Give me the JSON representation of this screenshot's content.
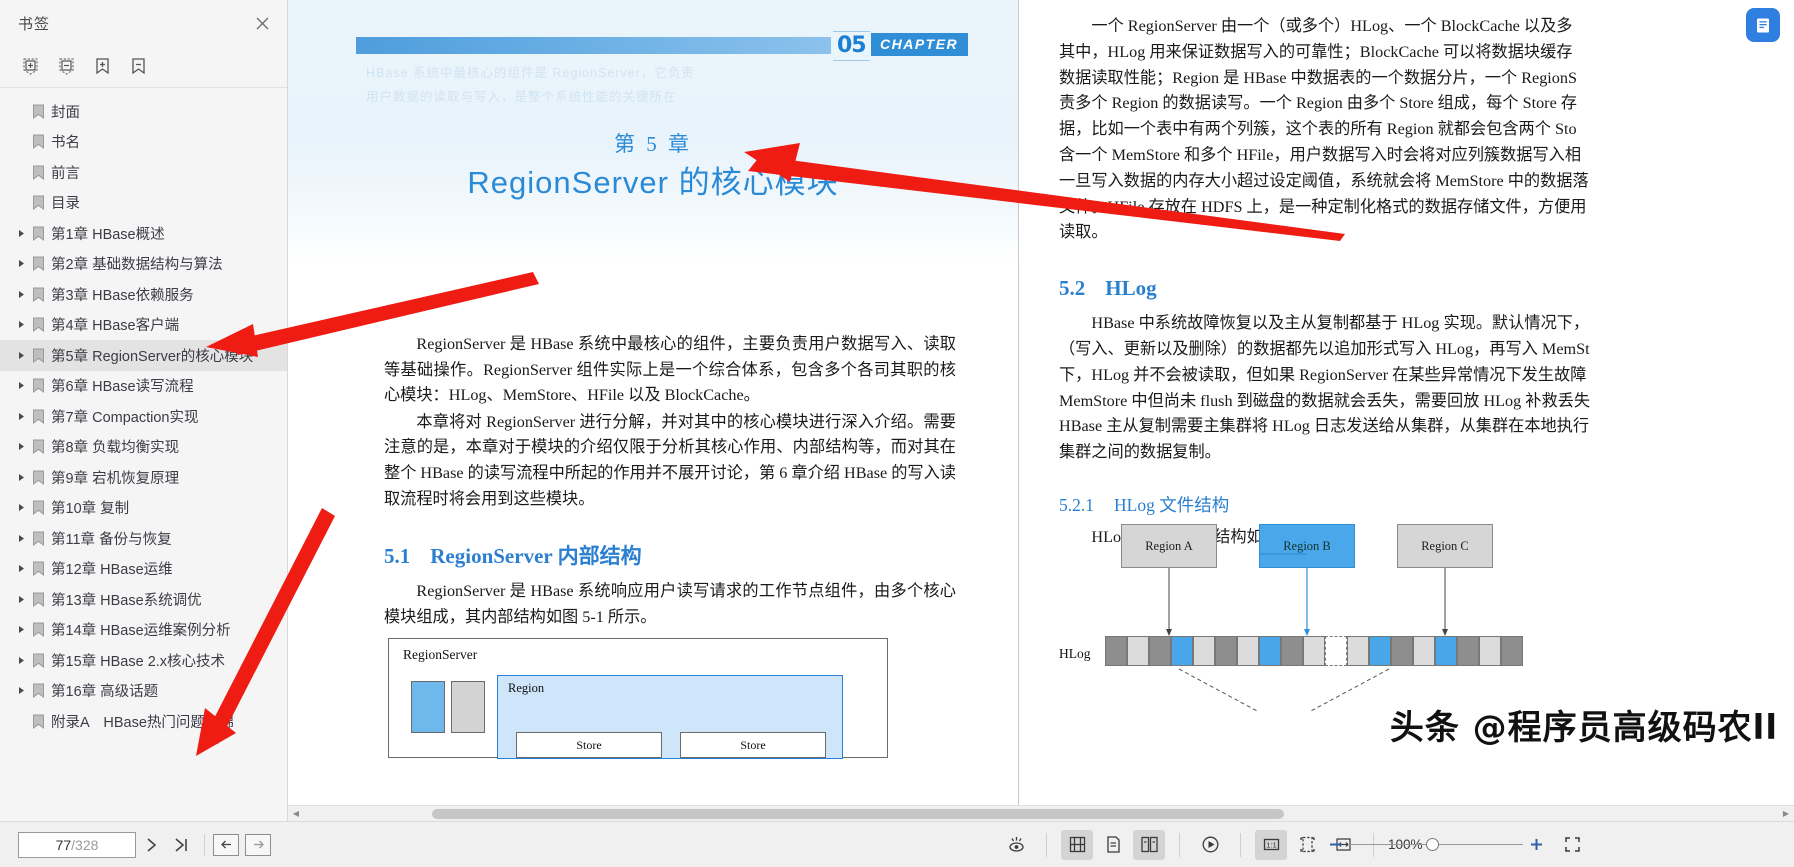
{
  "sidebar": {
    "title": "书签",
    "close_icon": "close-icon",
    "tools": [
      {
        "name": "expand-all-icon",
        "label": "展开全部"
      },
      {
        "name": "collapse-all-icon",
        "label": "收起全部"
      },
      {
        "name": "add-bookmark-icon",
        "label": "添加书签"
      },
      {
        "name": "remove-bookmark-icon",
        "label": "删除书签"
      }
    ],
    "items": [
      {
        "label": "封面",
        "expandable": false,
        "selected": false
      },
      {
        "label": "书名",
        "expandable": false,
        "selected": false
      },
      {
        "label": "前言",
        "expandable": false,
        "selected": false
      },
      {
        "label": "目录",
        "expandable": false,
        "selected": false
      },
      {
        "label": "第1章 HBase概述",
        "expandable": true,
        "selected": false
      },
      {
        "label": "第2章 基础数据结构与算法",
        "expandable": true,
        "selected": false
      },
      {
        "label": "第3章 HBase依赖服务",
        "expandable": true,
        "selected": false
      },
      {
        "label": "第4章 HBase客户端",
        "expandable": true,
        "selected": false
      },
      {
        "label": "第5章 RegionServer的核心模块",
        "expandable": true,
        "selected": true
      },
      {
        "label": "第6章 HBase读写流程",
        "expandable": true,
        "selected": false
      },
      {
        "label": "第7章 Compaction实现",
        "expandable": true,
        "selected": false
      },
      {
        "label": "第8章 负载均衡实现",
        "expandable": true,
        "selected": false
      },
      {
        "label": "第9章 宕机恢复原理",
        "expandable": true,
        "selected": false
      },
      {
        "label": "第10章 复制",
        "expandable": true,
        "selected": false
      },
      {
        "label": "第11章 备份与恢复",
        "expandable": true,
        "selected": false
      },
      {
        "label": "第12章 HBase运维",
        "expandable": true,
        "selected": false
      },
      {
        "label": "第13章 HBase系统调优",
        "expandable": true,
        "selected": false
      },
      {
        "label": "第14章 HBase运维案例分析",
        "expandable": true,
        "selected": false
      },
      {
        "label": "第15章 HBase 2.x核心技术",
        "expandable": true,
        "selected": false
      },
      {
        "label": "第16章 高级话题",
        "expandable": true,
        "selected": false
      },
      {
        "label": "附录A　HBase热门问题集锦",
        "expandable": false,
        "selected": false
      }
    ]
  },
  "left_page": {
    "chapter_number_badge": "05",
    "chapter_word_badge": "CHAPTER",
    "chapter_label": "第 5 章",
    "chapter_title": "RegionServer 的核心模块",
    "ghost_lines": [
      "HBase 系统中最核心的组件是 RegionServer，它负责",
      "用户数据的读取与写入，是整个系统性能的关键所在"
    ],
    "paragraphs": [
      "RegionServer 是 HBase 系统中最核心的组件，主要负责用户数据写入、读取等基础操作。RegionServer 组件实际上是一个综合体系，包含多个各司其职的核心模块：HLog、MemStore、HFile 以及 BlockCache。",
      "本章将对 RegionServer 进行分解，并对其中的核心模块进行深入介绍。需要注意的是，本章对于模块的介绍仅限于分析其核心作用、内部结构等，而对其在整个 HBase 的读写流程中所起的作用并不展开讨论，第 6 章介绍 HBase 的写入读取流程时将会用到这些模块。"
    ],
    "section": {
      "num": "5.1",
      "title": "RegionServer 内部结构"
    },
    "section_paragraph": "RegionServer 是 HBase 系统响应用户读写请求的工作节点组件，由多个核心模块组成，其内部结构如图 5-1 所示。",
    "figure": {
      "outer_label": "RegionServer",
      "region_label": "Region",
      "store_labels": [
        "Store",
        "Store"
      ]
    }
  },
  "right_page": {
    "paragraph_lines": [
      "一个 RegionServer 由一个（或多个）HLog、一个 BlockCache 以及多",
      "其中，HLog 用来保证数据写入的可靠性；BlockCache 可以将数据块缓存",
      "数据读取性能；Region 是 HBase 中数据表的一个数据分片，一个 RegionS",
      "责多个 Region 的数据读写。一个 Region 由多个 Store 组成，每个 Store 存",
      "据，比如一个表中有两个列簇，这个表的所有 Region 就都会包含两个 Sto",
      "含一个 MemStore 和多个 HFile，用户数据写入时会将对应列簇数据写入相",
      "一旦写入数据的内存大小超过设定阈值，系统就会将 MemStore 中的数据落",
      "文件。HFile 存放在 HDFS 上，是一种定制化格式的数据存储文件，方便用",
      "读取。"
    ],
    "section": {
      "num": "5.2",
      "title": "HLog"
    },
    "section_lines": [
      "HBase 中系统故障恢复以及主从复制都基于 HLog 实现。默认情况下，",
      "（写入、更新以及删除）的数据都先以追加形式写入 HLog，再写入 MemSt",
      "下，HLog 并不会被读取，但如果 RegionServer 在某些异常情况下发生故障",
      "MemStore 中但尚未 flush 到磁盘的数据就会丢失，需要回放 HLog 补救丢失",
      "HBase 主从复制需要主集群将 HLog 日志发送给从集群，从集群在本地执行",
      "集群之间的数据复制。"
    ],
    "subsection": {
      "num": "5.2.1",
      "title": "HLog 文件结构"
    },
    "subsection_paragraph": "HLog 文件的基本结构如图 5-2 所示。",
    "diagram": {
      "regions": [
        "Region A",
        "Region B",
        "Region C"
      ],
      "hlog_label": "HLog"
    }
  },
  "watermark": "头条 @程序员高级码农ll",
  "float_button": {
    "icon": "document-badge-icon"
  },
  "bottombar": {
    "current_page": "77",
    "total_pages": "/328",
    "next_page_icon": "chevron-right-icon",
    "last_page_icon": "last-page-icon",
    "back_icon": "arrow-left-icon",
    "forward_icon": "arrow-right-icon",
    "tools": [
      {
        "name": "read-aloud-icon",
        "active": false
      },
      {
        "name": "fit-width-icon",
        "active": true
      },
      {
        "name": "single-page-icon",
        "active": false
      },
      {
        "name": "dual-page-icon",
        "active": true
      },
      {
        "name": "slideshow-icon",
        "active": false
      },
      {
        "name": "actual-size-icon",
        "active": true
      },
      {
        "name": "fit-page-icon",
        "active": false
      },
      {
        "name": "fit-visible-icon",
        "active": false
      }
    ],
    "zoom_value": "100%",
    "zoom_out_icon": "minus-icon",
    "zoom_in_icon": "plus-icon",
    "fullscreen_icon": "fullscreen-icon"
  }
}
